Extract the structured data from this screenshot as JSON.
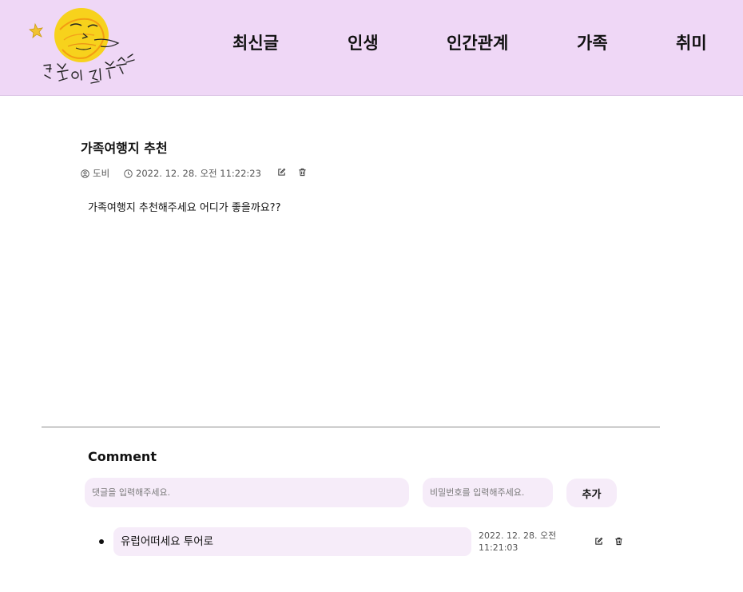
{
  "header": {
    "logo_text": "김쪽이 집합소",
    "nav": [
      {
        "label": "최신글"
      },
      {
        "label": "인생"
      },
      {
        "label": "인간관계"
      },
      {
        "label": "가족"
      },
      {
        "label": "취미"
      }
    ]
  },
  "post": {
    "title": "가족여행지 추천",
    "author": "도비",
    "datetime": "2022. 12. 28. 오전 11:22:23",
    "body": "가족여행지 추천해주세요 어디가 좋을까요??"
  },
  "comments_section": {
    "heading": "Comment",
    "comment_placeholder": "댓글을 입력해주세요.",
    "password_placeholder": "비밀번호를 입력해주세요.",
    "add_label": "추가",
    "items": [
      {
        "text": "유럽어떠세요 투어로",
        "date_line1": "2022. 12. 28. 오전",
        "date_line2": "11:21:03"
      }
    ]
  },
  "icons": {
    "author": "user-circle-icon",
    "time": "clock-icon",
    "edit": "edit-icon",
    "delete": "trash-icon"
  },
  "colors": {
    "header_bg": "#efd7f6",
    "input_bg": "#f6ecf9",
    "logo_yellow": "#f7d21c"
  }
}
